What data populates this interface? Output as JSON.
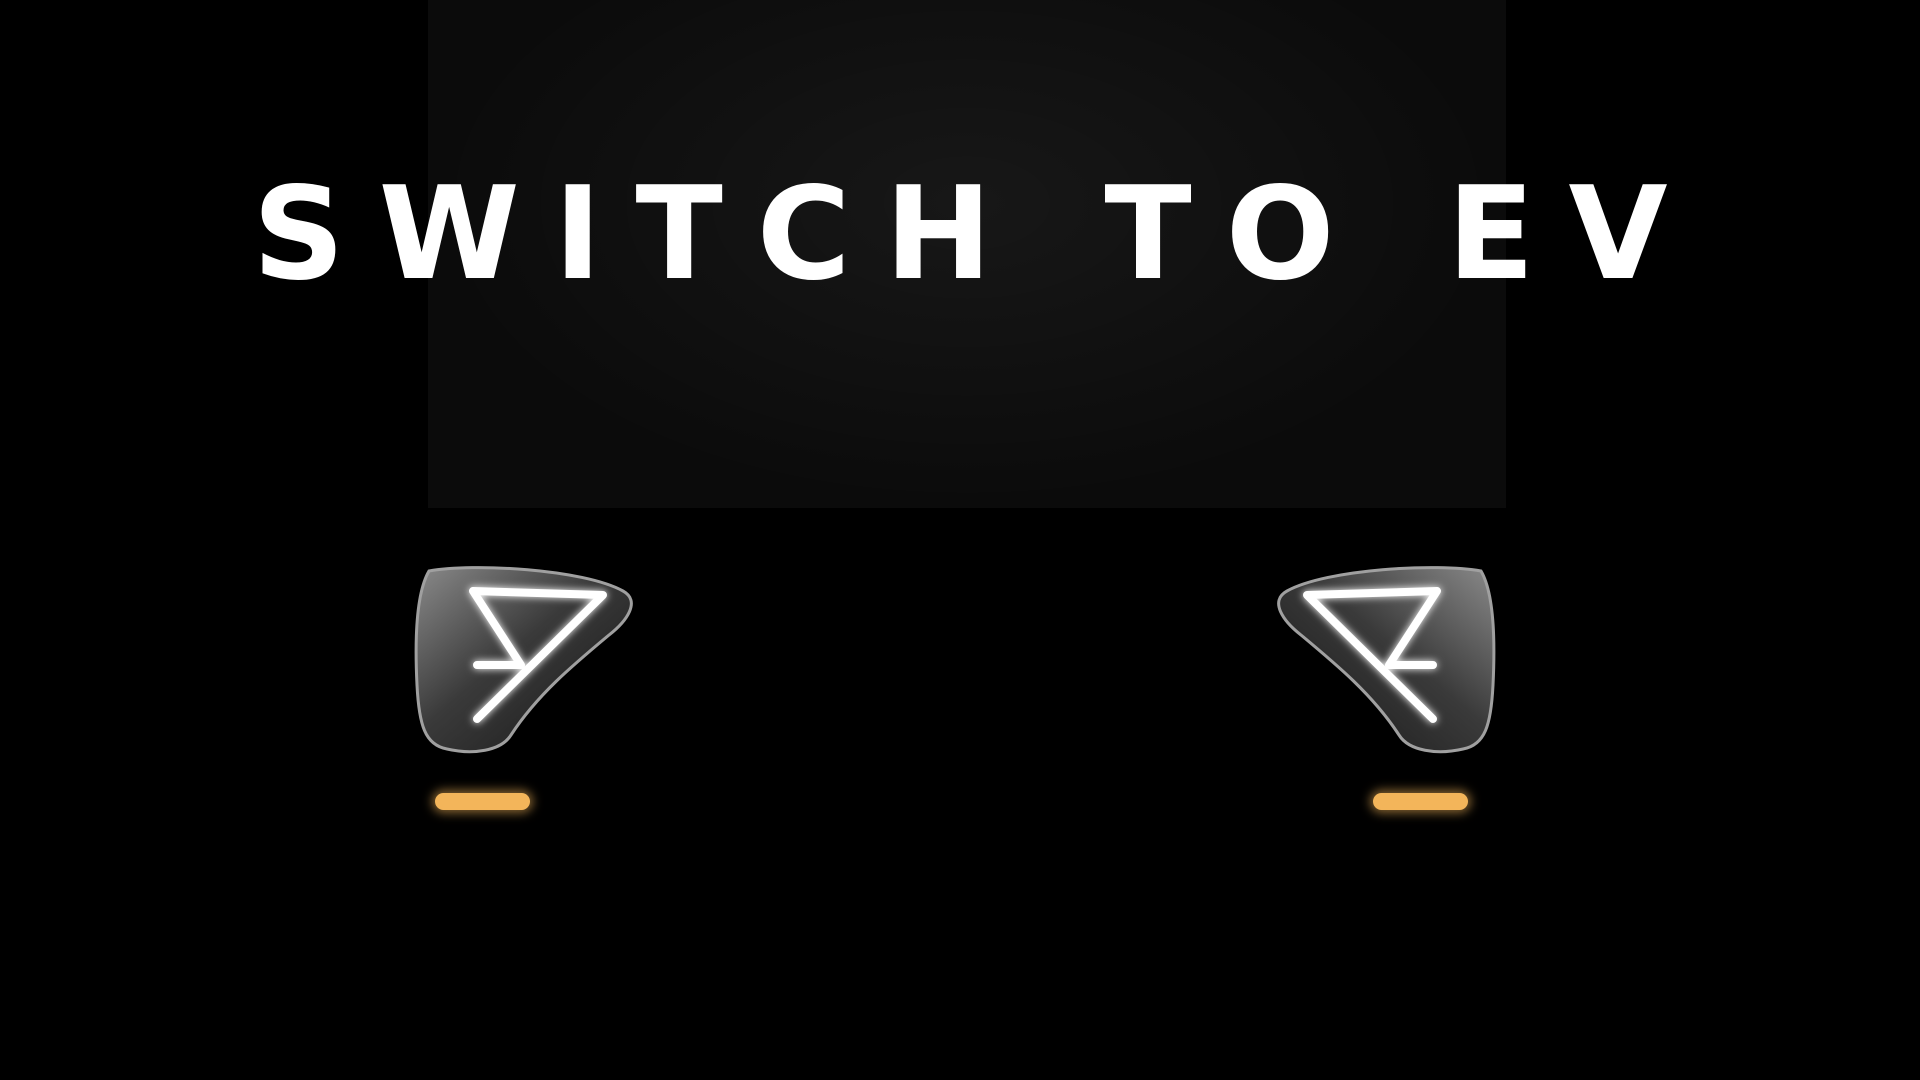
{
  "headline": {
    "text": "SWITCH TO EV"
  },
  "colors": {
    "background": "#000000",
    "headline": "#ffffff",
    "light_bar": "#ffffff",
    "housing": "#6e6e6e",
    "indicator": "#f3b55a"
  },
  "scene": {
    "left_headlamp_icon": "triangle-light-icon",
    "right_headlamp_icon": "triangle-light-icon",
    "indicator_icon": "turn-signal-icon"
  }
}
